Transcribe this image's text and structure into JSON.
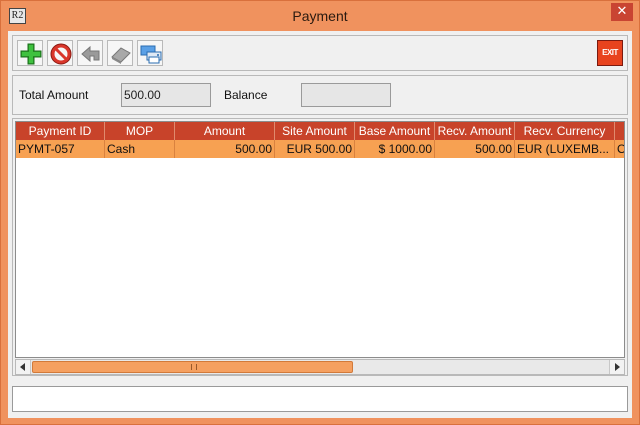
{
  "window": {
    "title": "Payment",
    "app_icon_text": "R2",
    "close_glyph": "✕"
  },
  "toolbar": {
    "buttons": [
      "add-icon",
      "cancel-icon",
      "back-icon",
      "delete-icon",
      "print-icon"
    ],
    "exit_label": "EXIT"
  },
  "form": {
    "total_amount_label": "Total Amount",
    "total_amount_value": "500.00",
    "balance_label": "Balance",
    "balance_value": ""
  },
  "table": {
    "columns": [
      "Payment ID",
      "MOP",
      "Amount",
      "Site Amount",
      "Base Amount",
      "Recv. Amount",
      "Recv. Currency",
      ""
    ],
    "rows": [
      [
        "PYMT-057",
        "Cash",
        "500.00",
        "EUR 500.00",
        "$ 1000.00",
        "500.00",
        "EUR (LUXEMB...",
        "O"
      ]
    ]
  },
  "colors": {
    "titlebar": "#f0925e",
    "header": "#c8432a",
    "selected_row": "#f7a152"
  },
  "status": {
    "text": ""
  }
}
